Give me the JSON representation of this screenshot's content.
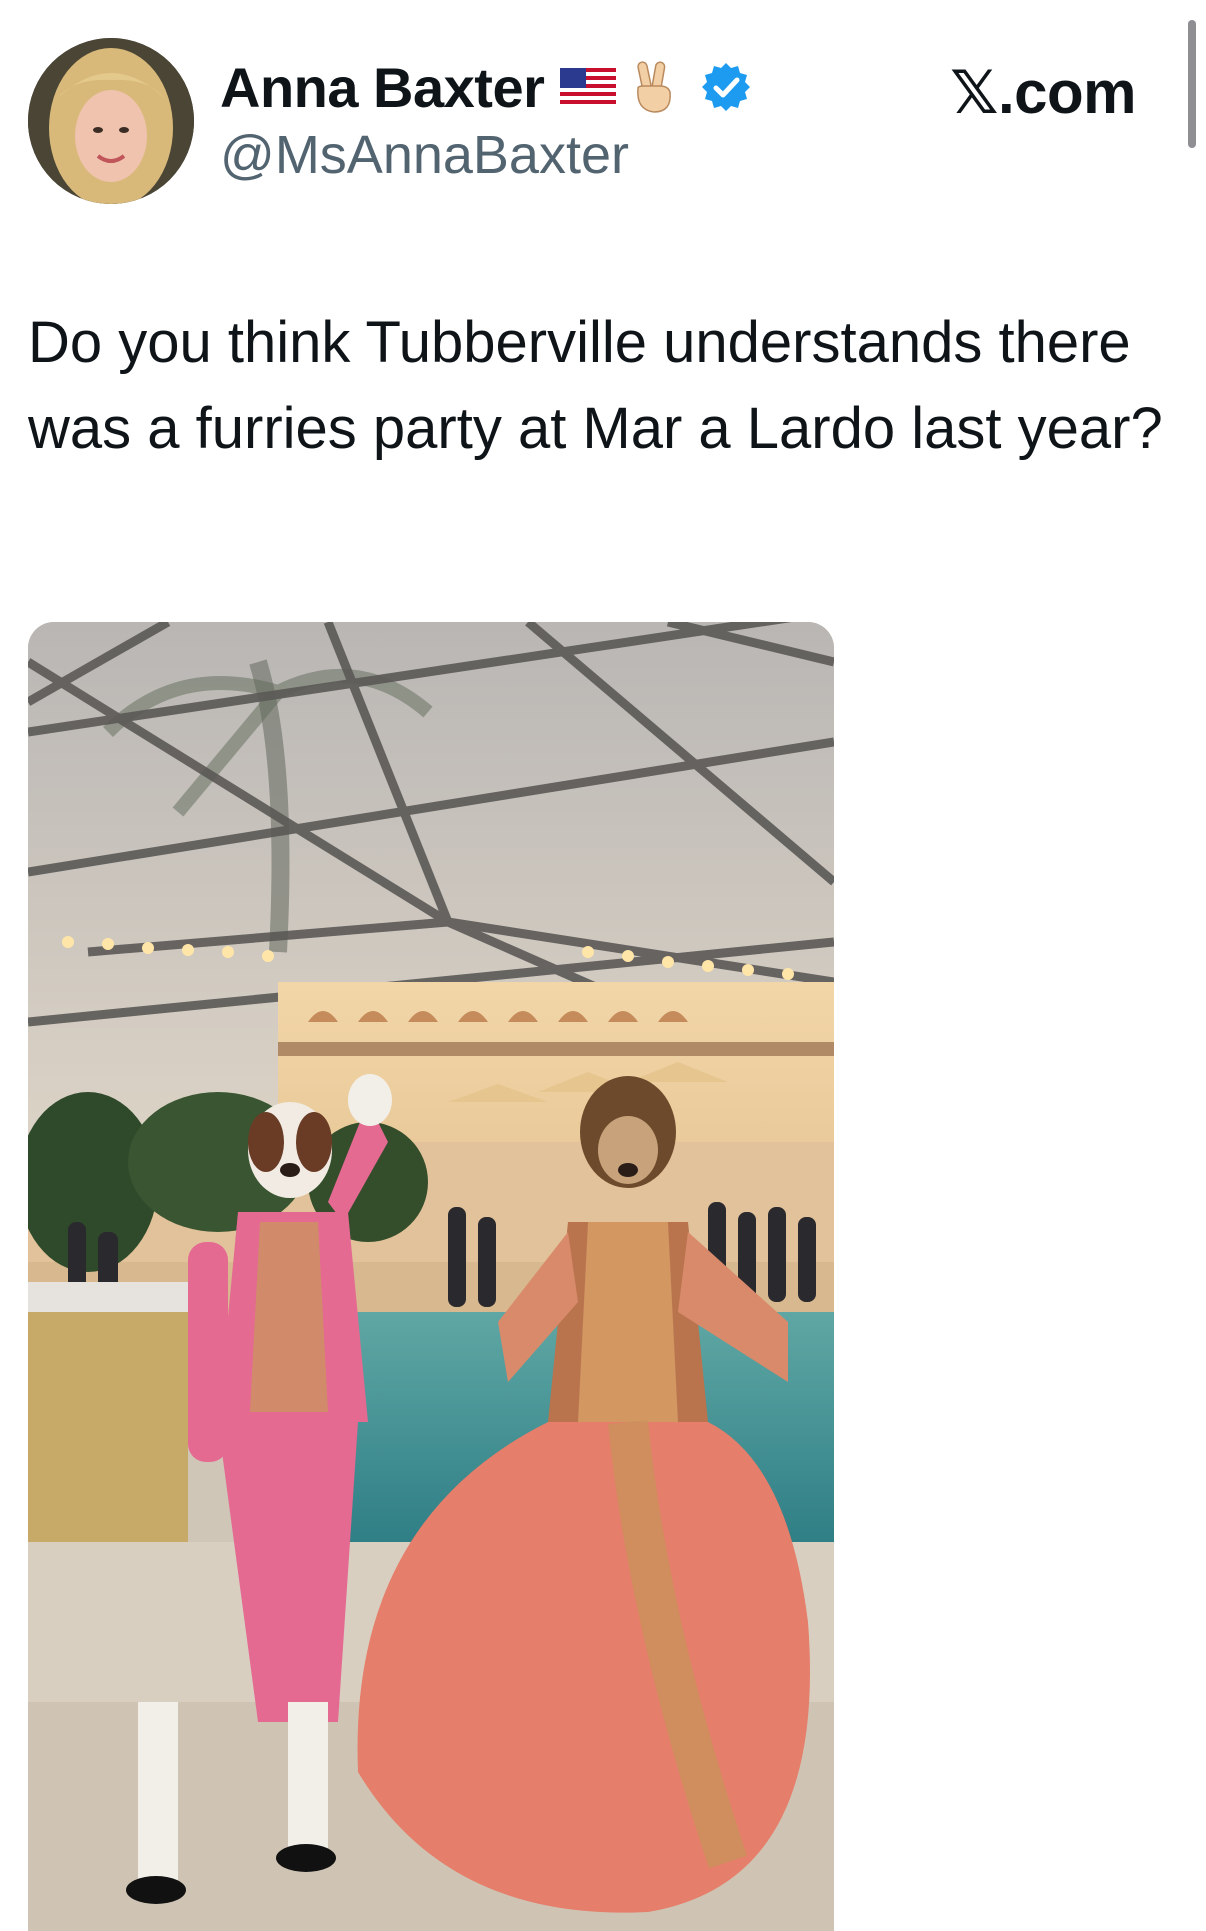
{
  "author": {
    "display_name": "Anna Baxter",
    "handle": "@MsAnnaBaxter",
    "badges": [
      "us-flag-icon",
      "victory-hand-icon",
      "verified-badge-icon"
    ],
    "verified_color": "#1d9bf0"
  },
  "site_label": "𝕏.com",
  "tweet": {
    "text": "Do you think Tubberville understands there was a furries party at Mar a Lardo last year?"
  },
  "colors": {
    "text_primary": "#0f1419",
    "text_secondary": "#536471",
    "background": "#ffffff"
  }
}
